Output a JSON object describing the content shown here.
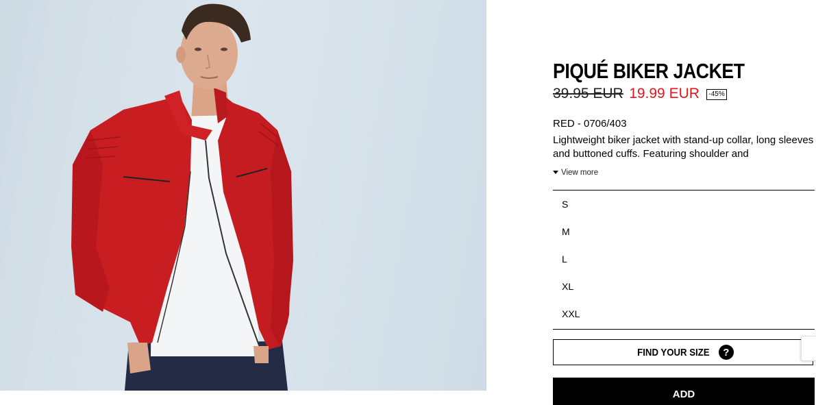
{
  "product": {
    "image_alt": "Model wearing red piqué biker jacket over white t-shirt",
    "title": "PIQUÉ BIKER JACKET",
    "old_price": "39.95 EUR",
    "new_price": "19.99 EUR",
    "discount": "-45%",
    "color_ref": "RED - 0706/403",
    "description": "Lightweight biker jacket with stand-up collar, long sleeves and buttoned cuffs. Featuring shoulder and",
    "view_more": "View more"
  },
  "sizes": [
    "S",
    "M",
    "L",
    "XL",
    "XXL"
  ],
  "buttons": {
    "find_size": "FIND YOUR SIZE",
    "find_size_icon": "?",
    "add": "ADD"
  },
  "colors": {
    "sale_red": "#e3151b",
    "jacket_red": "#c81e22",
    "background": "#d6e1ea"
  }
}
